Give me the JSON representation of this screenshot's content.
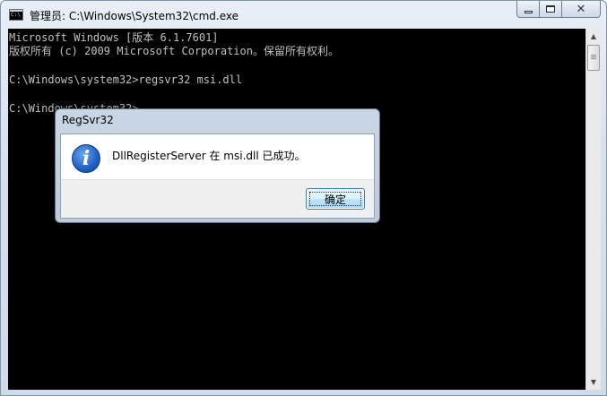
{
  "window": {
    "title": "管理员: C:\\Windows\\System32\\cmd.exe",
    "icon_text": "C:\\"
  },
  "console": {
    "lines": [
      "Microsoft Windows [版本 6.1.7601]",
      "版权所有 (c) 2009 Microsoft Corporation。保留所有权利。",
      "",
      "C:\\Windows\\system32>regsvr32 msi.dll",
      "",
      "C:\\Windows\\system32>"
    ]
  },
  "dialog": {
    "title": "RegSvr32",
    "message": "DllRegisterServer 在 msi.dll 已成功。",
    "ok_label": "确定",
    "icon": "info-icon"
  },
  "colors": {
    "console_bg": "#000000",
    "console_text": "#c0c0c0",
    "button_border": "#3c7fb1"
  }
}
